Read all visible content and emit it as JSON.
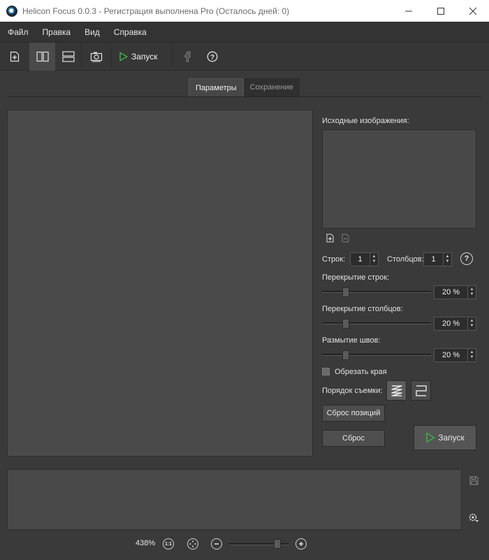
{
  "window": {
    "title": "Helicon Focus 0.0.3 - Регистрация выполнена Pro  (Осталось дней: 0)",
    "minimize": "—",
    "maximize": "☐",
    "close": "✕"
  },
  "menu": [
    "Файл",
    "Правка",
    "Вид",
    "Справка"
  ],
  "toolbar": {
    "run_label": "Запуск",
    "icons": [
      "add-file-icon",
      "two-columns-icon",
      "two-rows-icon",
      "camera-icon",
      "play-icon",
      "facebook-icon",
      "help-icon"
    ]
  },
  "tabs": [
    {
      "label": "Параметры",
      "active": true
    },
    {
      "label": "Сохранение",
      "active": false
    }
  ],
  "panel": {
    "source_images_label": "Исходные изображения:",
    "rows_label": "Строк:",
    "rows_value": "1",
    "cols_label": "Столбцов:",
    "cols_value": "1",
    "help": "?",
    "row_overlap_label": "Перекрытие строк:",
    "row_overlap_value": "20 %",
    "row_overlap_fraction": 0.2,
    "col_overlap_label": "Перекрытие столбцов:",
    "col_overlap_value": "20 %",
    "col_overlap_fraction": 0.2,
    "seam_blur_label": "Размытие швов:",
    "seam_blur_value": "20 %",
    "seam_blur_fraction": 0.2,
    "crop_edges_label": "Обрезать края",
    "shooting_order_label": "Порядок съемки:",
    "reset_positions_label": "Сброс позиций",
    "reset_label": "Сброс",
    "run_label": "Запуск"
  },
  "zoom": {
    "percent": "438%",
    "fit_label": "1:1",
    "level_fraction": 0.85
  },
  "colors": {
    "run_green": "#3fae49",
    "background": "#3a3a3a"
  }
}
